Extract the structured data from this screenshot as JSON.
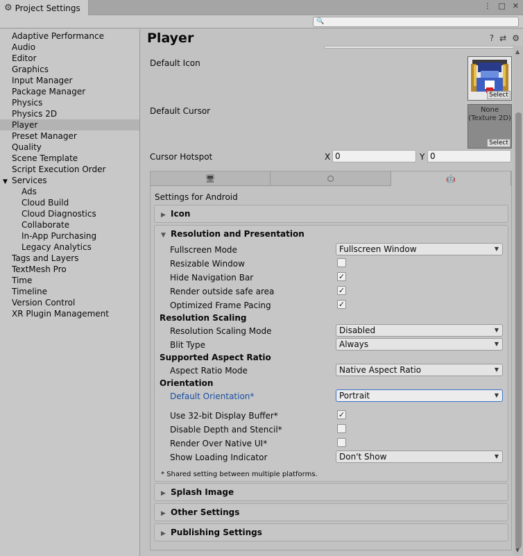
{
  "window": {
    "tab_title": "Project Settings",
    "controls": [
      "⋮",
      "□",
      "✕"
    ]
  },
  "search": {
    "placeholder": ""
  },
  "sidebar": {
    "items": [
      {
        "label": "Adaptive Performance",
        "level": 0
      },
      {
        "label": "Audio",
        "level": 0
      },
      {
        "label": "Editor",
        "level": 0
      },
      {
        "label": "Graphics",
        "level": 0
      },
      {
        "label": "Input Manager",
        "level": 0
      },
      {
        "label": "Package Manager",
        "level": 0
      },
      {
        "label": "Physics",
        "level": 0
      },
      {
        "label": "Physics 2D",
        "level": 0
      },
      {
        "label": "Player",
        "level": 0,
        "selected": true
      },
      {
        "label": "Preset Manager",
        "level": 0
      },
      {
        "label": "Quality",
        "level": 0
      },
      {
        "label": "Scene Template",
        "level": 0
      },
      {
        "label": "Script Execution Order",
        "level": 0
      },
      {
        "label": "Services",
        "level": 0,
        "group": true
      },
      {
        "label": "Ads",
        "level": 1
      },
      {
        "label": "Cloud Build",
        "level": 1
      },
      {
        "label": "Cloud Diagnostics",
        "level": 1
      },
      {
        "label": "Collaborate",
        "level": 1
      },
      {
        "label": "In-App Purchasing",
        "level": 1
      },
      {
        "label": "Legacy Analytics",
        "level": 1
      },
      {
        "label": "Tags and Layers",
        "level": 0
      },
      {
        "label": "TextMesh Pro",
        "level": 0
      },
      {
        "label": "Time",
        "level": 0
      },
      {
        "label": "Timeline",
        "level": 0
      },
      {
        "label": "Version Control",
        "level": 0
      },
      {
        "label": "XR Plugin Management",
        "level": 0
      }
    ]
  },
  "main": {
    "title": "Player",
    "default_icon_label": "Default Icon",
    "default_cursor_label": "Default Cursor",
    "cursor_texture_none": "None\n(Texture 2D)",
    "select_label": "Select",
    "cursor_hotspot_label": "Cursor Hotspot",
    "hotspot_x_label": "X",
    "hotspot_x_value": "0",
    "hotspot_y_label": "Y",
    "hotspot_y_value": "0"
  },
  "platform": {
    "settings_for": "Settings for Android",
    "sections": {
      "icon": "Icon",
      "resolution": "Resolution and Presentation",
      "splash": "Splash Image",
      "other": "Other Settings",
      "publishing": "Publishing Settings"
    },
    "resolution": {
      "fullscreen_mode": {
        "label": "Fullscreen Mode",
        "value": "Fullscreen Window"
      },
      "resizable_window": {
        "label": "Resizable Window",
        "checked": false
      },
      "hide_nav_bar": {
        "label": "Hide Navigation Bar",
        "checked": true
      },
      "render_outside_safe": {
        "label": "Render outside safe area",
        "checked": true
      },
      "optimized_frame_pacing": {
        "label": "Optimized Frame Pacing",
        "checked": true
      },
      "resolution_scaling_head": "Resolution Scaling",
      "resolution_scaling_mode": {
        "label": "Resolution Scaling Mode",
        "value": "Disabled"
      },
      "blit_type": {
        "label": "Blit Type",
        "value": "Always"
      },
      "aspect_head": "Supported Aspect Ratio",
      "aspect_ratio_mode": {
        "label": "Aspect Ratio Mode",
        "value": "Native Aspect Ratio"
      },
      "orientation_head": "Orientation",
      "default_orientation": {
        "label": "Default Orientation*",
        "value": "Portrait"
      },
      "use_32bit": {
        "label": "Use 32-bit Display Buffer*",
        "checked": true
      },
      "disable_depth": {
        "label": "Disable Depth and Stencil*",
        "checked": false
      },
      "render_over_native": {
        "label": "Render Over Native UI*",
        "checked": false
      },
      "show_loading": {
        "label": "Show Loading Indicator",
        "value": "Don't Show"
      },
      "footnote": "* Shared setting between multiple platforms."
    }
  }
}
